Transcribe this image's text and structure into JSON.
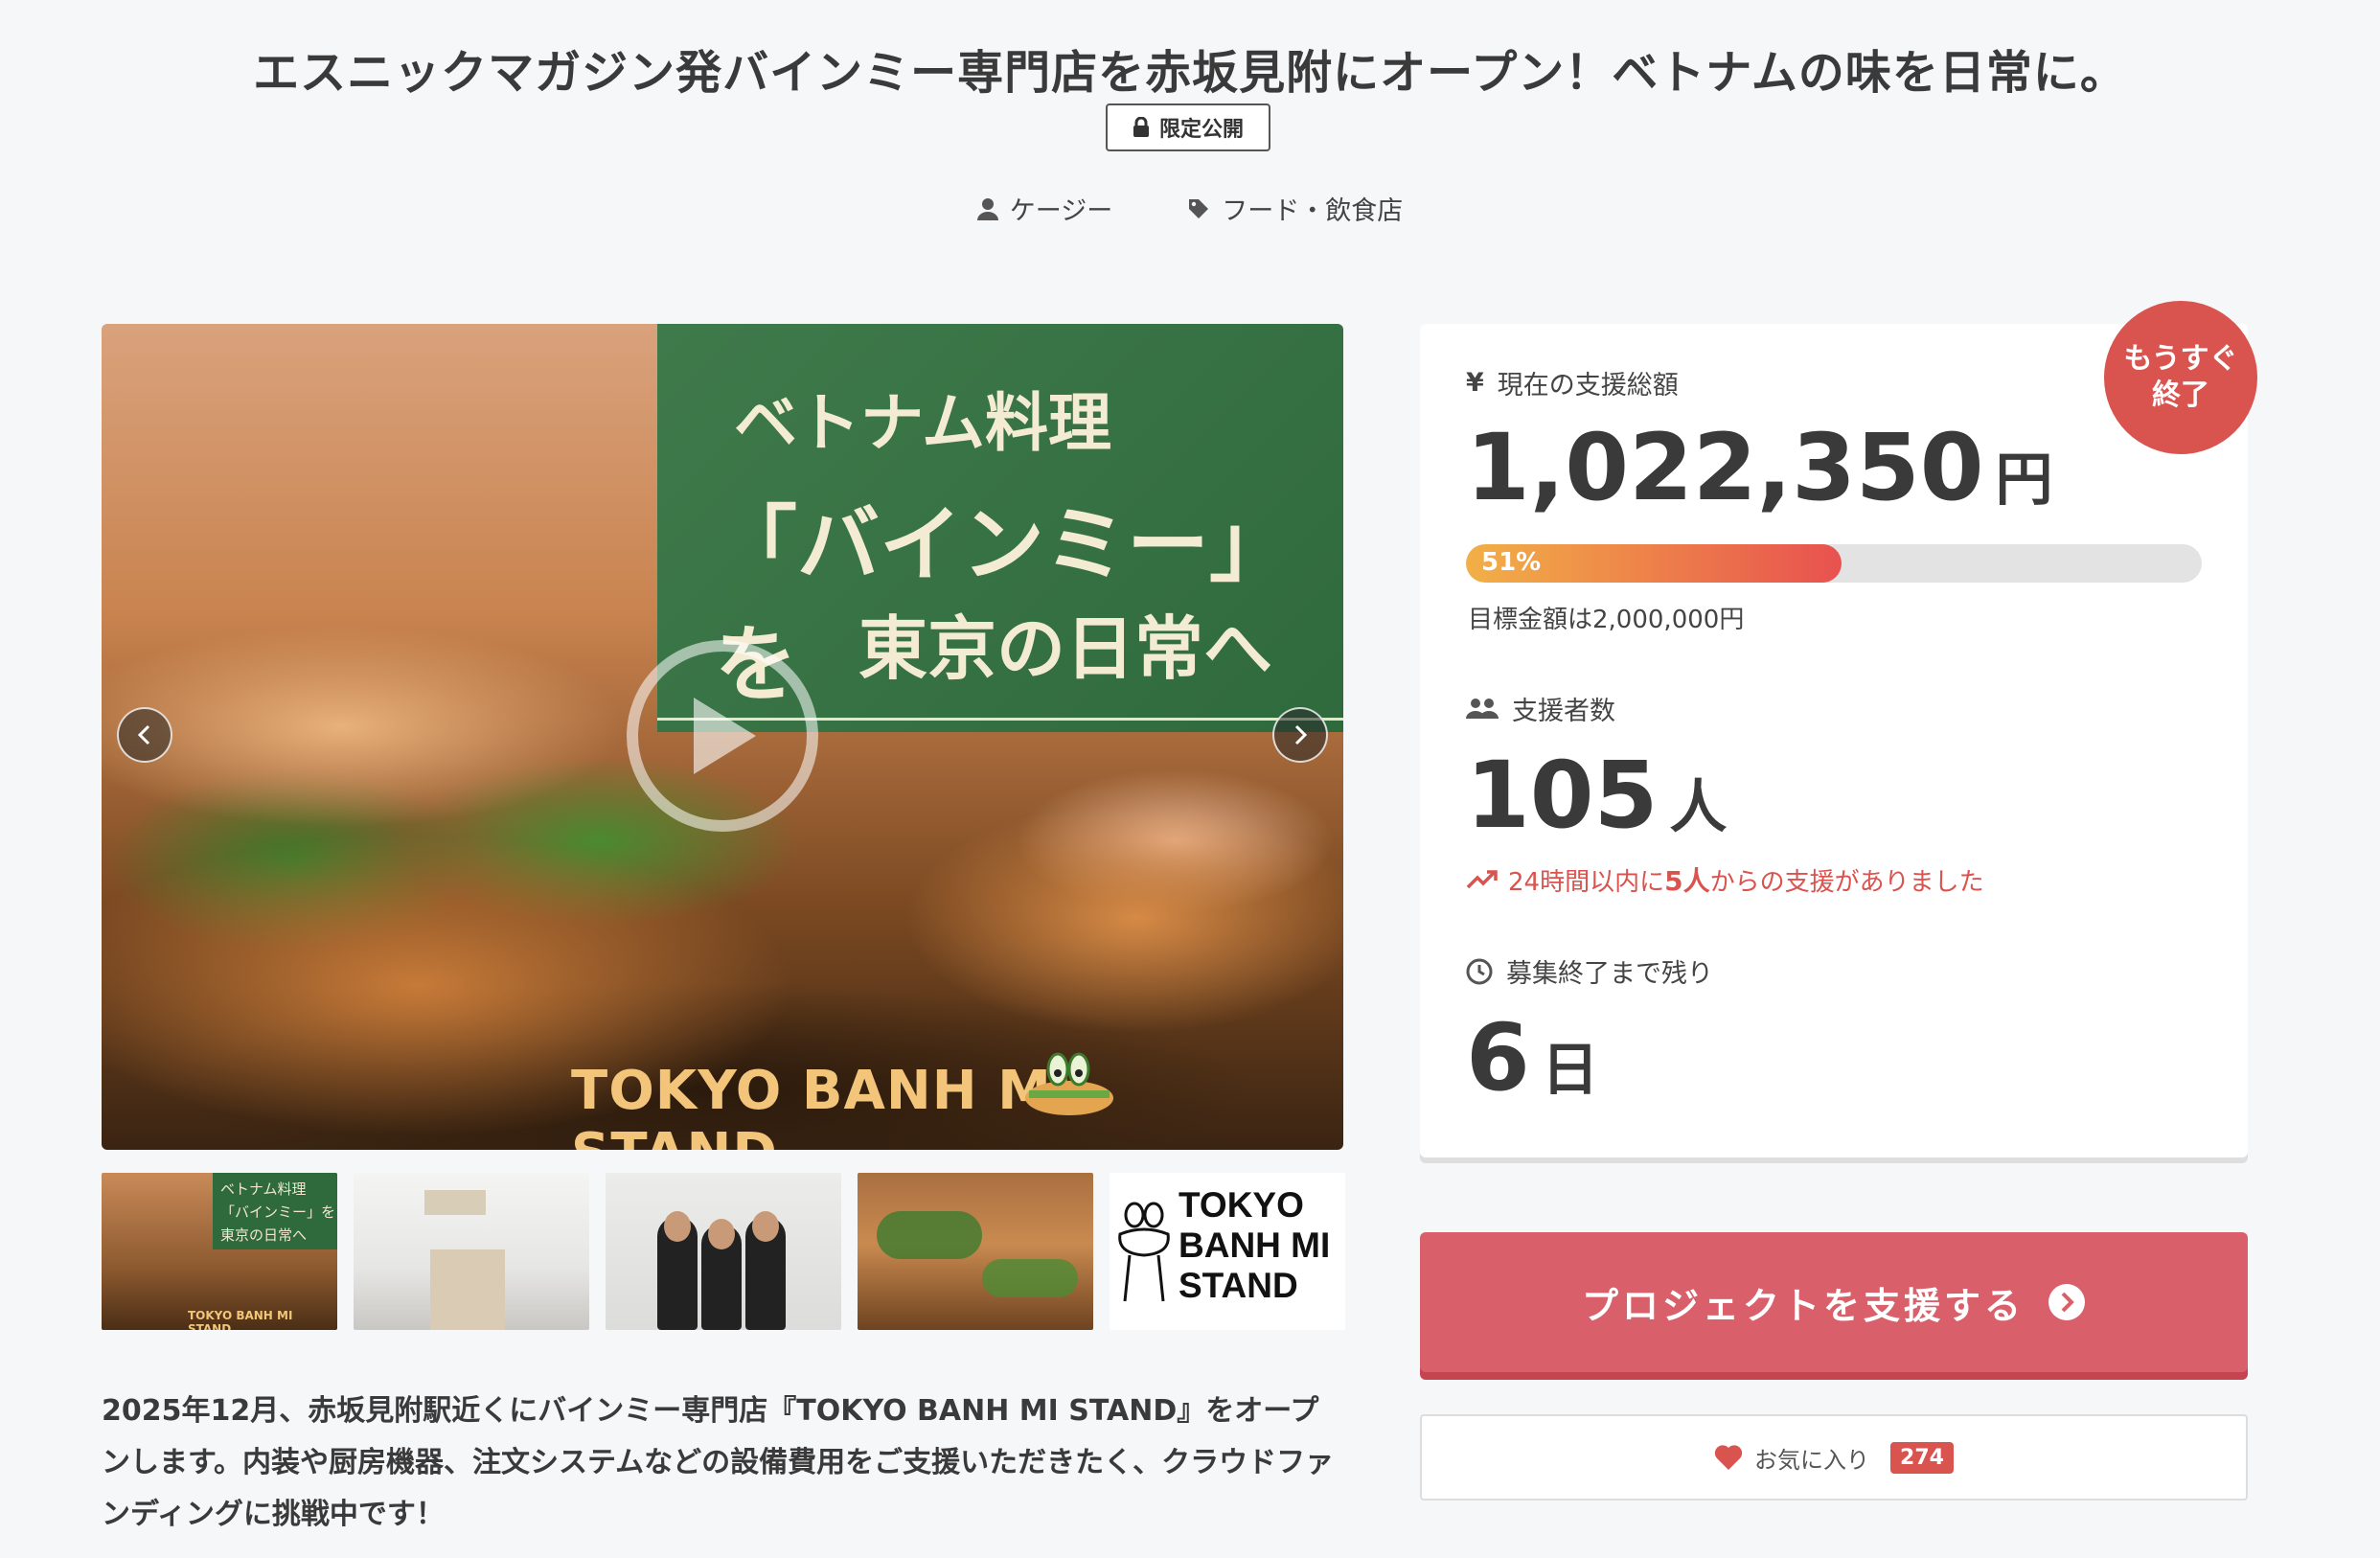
{
  "header": {
    "title": "エスニックマガジン発バインミー専門店を赤坂見附にオープン！ベトナムの味を日常に。",
    "limited_label": "限定公開",
    "author": "ケージー",
    "category": "フード・飲食店"
  },
  "main_visual": {
    "line1": "ベトナム料理",
    "line2": "「バインミー」を",
    "line3": "東京の日常へ",
    "brand": "TOKYO BANH MI",
    "brand_suffix": "STAND"
  },
  "thumbnails": {
    "t1_line1": "ベトナム料理",
    "t1_line2": "「バインミー」を",
    "t1_line3": "東京の日常へ",
    "t1_brand": "TOKYO BANH MI  STAND",
    "t5_word1": "TOKYO",
    "t5_word2": "BANH MI",
    "t5_word3": "STAND"
  },
  "description": "2025年12月、赤坂見附駅近くにバインミー専門店『TOKYO BANH MI STAND』をオープンします。内装や厨房機器、注文システムなどの設備費用をご支援いただきたく、クラウドファンディングに挑戦中です！",
  "stats": {
    "badge_line1": "もうすぐ",
    "badge_line2": "終了",
    "total_label": "現在の支援総額",
    "total_amount": "1,022,350",
    "yen_unit": "円",
    "progress_percent": 51,
    "progress_text": "51%",
    "goal_text": "目標金額は2,000,000円",
    "backers_label": "支援者数",
    "backers_count": "105",
    "backers_unit": "人",
    "trend_prefix": "24時間以内に",
    "trend_count": "5人",
    "trend_suffix": "からの支援がありました",
    "remaining_label": "募集終了まで残り",
    "remaining_days": "6",
    "days_unit": "日"
  },
  "actions": {
    "support_label": "プロジェクトを支援する",
    "favorite_label": "お気に入り",
    "favorite_count": "274"
  },
  "colors": {
    "accent": "#d9534f",
    "button": "#d9606a",
    "progress_start": "#f2b046",
    "progress_end": "#e8514f"
  }
}
